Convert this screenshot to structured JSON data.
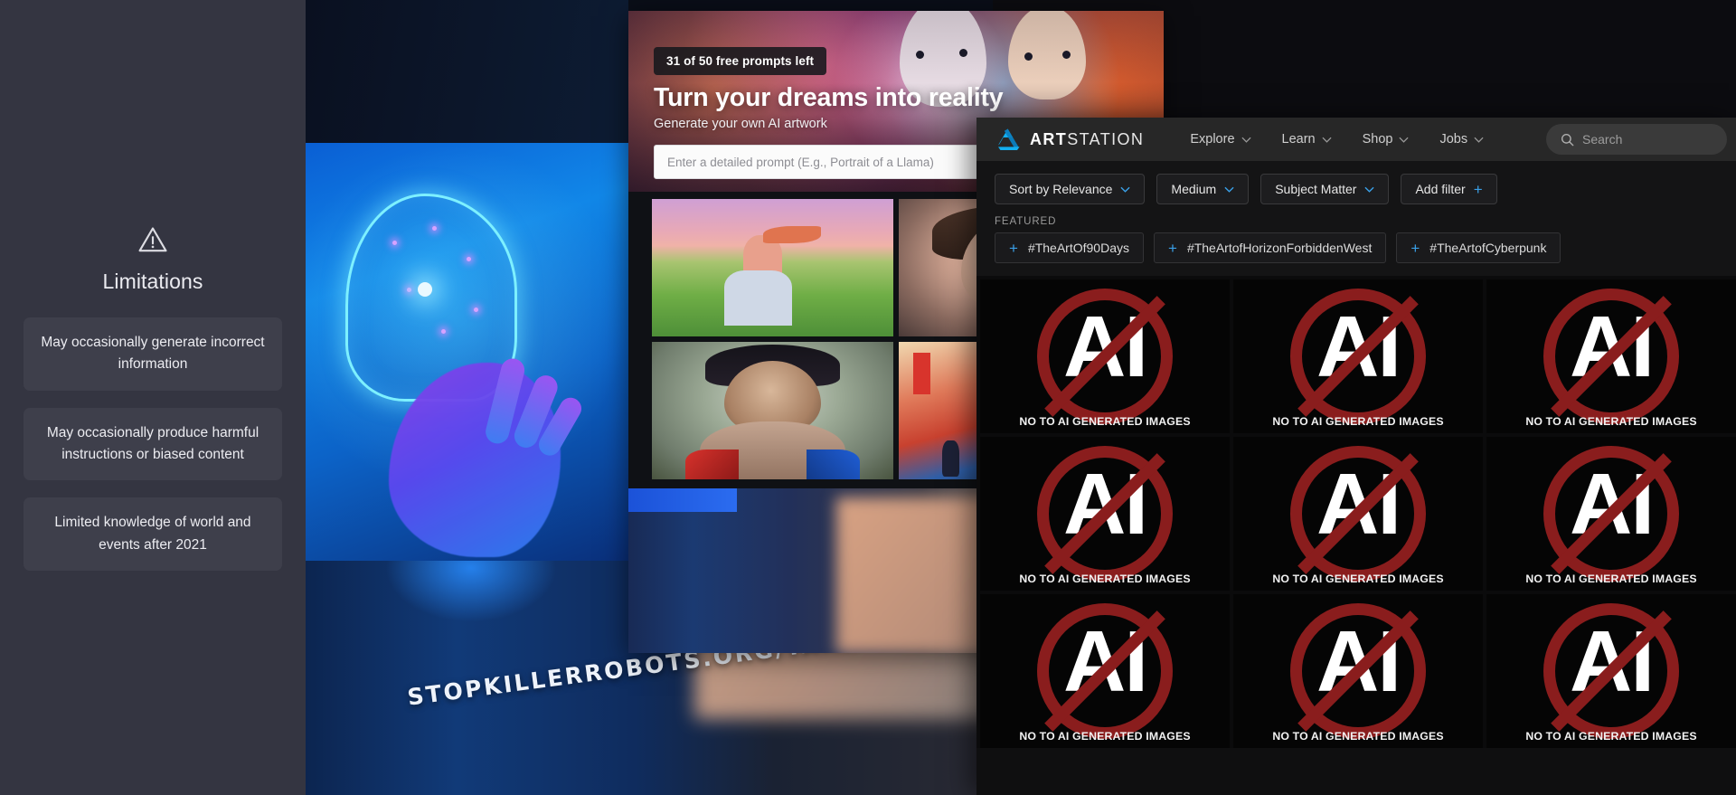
{
  "chatgpt": {
    "icon": "warning-triangle-icon",
    "title": "Limitations",
    "cards": [
      "May occasionally generate incorrect information",
      "May occasionally produce harmful instructions or biased content",
      "Limited knowledge of world and events after 2021"
    ]
  },
  "stop_killer_robots": {
    "url_text": "STOPKILLERROBOTS.ORG/TAKE-ACTION"
  },
  "dalle": {
    "badge": "31 of 50 free prompts left",
    "heading": "Turn your dreams into reality",
    "subheading": "Generate your own AI artwork",
    "prompt_placeholder": "Enter a detailed prompt (E.g., Portrait of a Llama)",
    "prompt_value": "",
    "tiles": [
      "woman-in-cornfield-at-sunset",
      "photoreal-female-portrait",
      "superhero-male-portrait",
      "neon-asian-street-scene"
    ]
  },
  "artstation": {
    "logo_icon": "artstation-logo-icon",
    "wordmark_bold": "ART",
    "wordmark_light": "STATION",
    "nav": [
      {
        "label": "Explore",
        "icon": "chevron-down-icon"
      },
      {
        "label": "Learn",
        "icon": "chevron-down-icon"
      },
      {
        "label": "Shop",
        "icon": "chevron-down-icon"
      },
      {
        "label": "Jobs",
        "icon": "chevron-down-icon"
      }
    ],
    "search": {
      "icon": "search-icon",
      "placeholder": "Search"
    },
    "filters": [
      {
        "label": "Sort by Relevance",
        "icon": "chevron-down-icon"
      },
      {
        "label": "Medium",
        "icon": "chevron-down-icon"
      },
      {
        "label": "Subject Matter",
        "icon": "chevron-down-icon"
      },
      {
        "label": "Add filter",
        "icon": "plus-icon"
      }
    ],
    "featured_label": "FEATURED",
    "featured_tags": [
      {
        "icon": "plus-icon",
        "label": "#TheArtOf90Days"
      },
      {
        "icon": "plus-icon",
        "label": "#TheArtofHorizonForbiddenWest"
      },
      {
        "icon": "plus-icon",
        "label": "#TheArtofCyberpunk"
      }
    ],
    "protest_caption": "NO TO AI GENERATED IMAGES",
    "protest_glyph": "AI",
    "protest_tile_count": 9,
    "colors": {
      "accent_blue": "#3aa0e8",
      "nav_bg": "#272727",
      "panel_bg": "#141415",
      "protest_red": "#8a1d1d"
    }
  }
}
